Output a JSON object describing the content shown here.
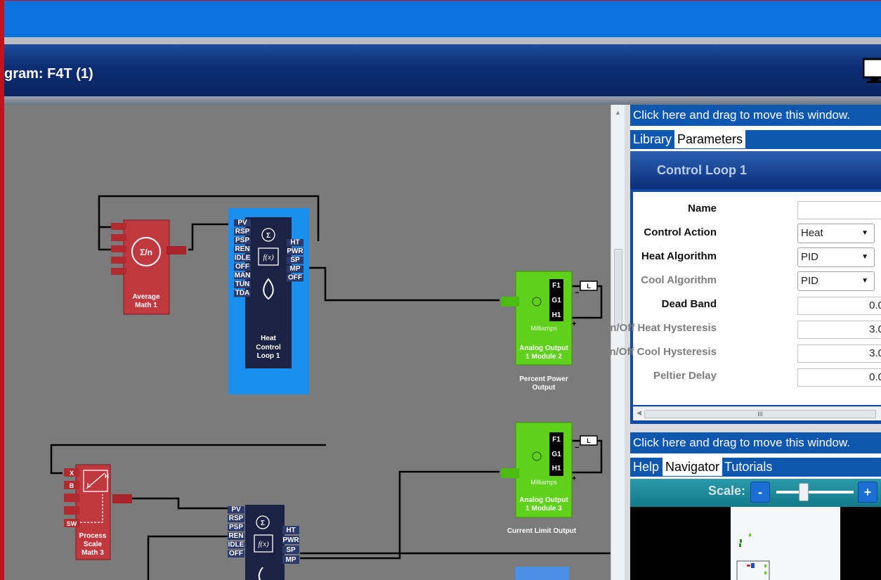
{
  "window": {
    "title": "gram: F4T (1)"
  },
  "params_panel": {
    "drag_hint": "Click here and drag to move this window.",
    "tabs": [
      {
        "label": "Library",
        "active": false
      },
      {
        "label": "Parameters",
        "active": true
      }
    ],
    "section_title": "Control Loop 1",
    "rows": [
      {
        "label": "Name",
        "value": "",
        "kind": "text",
        "enabled": true
      },
      {
        "label": "Control Action",
        "value": "Heat",
        "kind": "select",
        "enabled": true
      },
      {
        "label": "Heat Algorithm",
        "value": "PID",
        "kind": "select",
        "enabled": true
      },
      {
        "label": "Cool Algorithm",
        "value": "PID",
        "kind": "select",
        "enabled": false
      },
      {
        "label": "Dead Band",
        "value": "0.0",
        "kind": "number",
        "enabled": true
      },
      {
        "label": "On/Off Heat Hysteresis",
        "value": "3.0",
        "kind": "number",
        "enabled": false
      },
      {
        "label": "On/Off Cool Hysteresis",
        "value": "3.0",
        "kind": "number",
        "enabled": false
      },
      {
        "label": "Peltier Delay",
        "value": "0.0",
        "kind": "number",
        "enabled": false
      }
    ],
    "hscroll_grip": "III"
  },
  "nav_panel": {
    "drag_hint": "Click here and drag to move this window.",
    "tabs": [
      {
        "label": "Help",
        "active": false
      },
      {
        "label": "Navigator",
        "active": true
      },
      {
        "label": "Tutorials",
        "active": false
      }
    ],
    "scale_label": "Scale:",
    "minus": "-",
    "plus": "+"
  },
  "diagram": {
    "blocks": {
      "average": {
        "line1": "Average",
        "line2": "Math 1",
        "glyph": "Σ/n"
      },
      "loop1": {
        "inputs": [
          "PV",
          "RSP",
          "PSP",
          "REN",
          "IDLE",
          "OFF",
          "MAN",
          "TUN",
          "TDA"
        ],
        "outputs": [
          "HT",
          "PWR",
          "SP",
          "MP",
          "OFF"
        ],
        "line1": "Heat",
        "line2": "Control",
        "line3": "Loop 1",
        "glyph": "f(x)",
        "sum": "Σ"
      },
      "ao2": {
        "pins": [
          "F1",
          "G1",
          "H1"
        ],
        "unit": "Milliamps",
        "line1": "Analog Output",
        "line2": "1 Module 2",
        "load": "L",
        "minus": "−",
        "plus": "+"
      },
      "ao2_caption": {
        "line1": "Percent Power",
        "line2": "Output"
      },
      "ao3": {
        "pins": [
          "F1",
          "G1",
          "H1"
        ],
        "unit": "Milliamps",
        "line1": "Analog Output",
        "line2": "1 Module 3",
        "load": "L",
        "minus": "−",
        "plus": "+"
      },
      "ao3_caption": "Current Limit Output",
      "scale": {
        "inputs": [
          "X",
          "B",
          "SW"
        ],
        "line1": "Process",
        "line2": "Scale",
        "line3": "Math 3",
        "glyph_h": "H",
        "glyph_l": "L"
      },
      "loop2": {
        "inputs": [
          "PV",
          "RSP",
          "PSP",
          "REN",
          "IDLE",
          "OFF"
        ],
        "outputs": [
          "HT",
          "PWR",
          "SP",
          "MP"
        ],
        "glyph": "f(x)",
        "sum": "Σ"
      }
    }
  },
  "colors": {
    "title_bar": "#0d2d72",
    "top_bar": "#0b72dd",
    "canvas": "#7b7b7b",
    "math_block": "#c0393f",
    "loop_block": "#1b2344",
    "loop_highlight": "#1a8ff0",
    "output_block": "#5fd11a"
  }
}
